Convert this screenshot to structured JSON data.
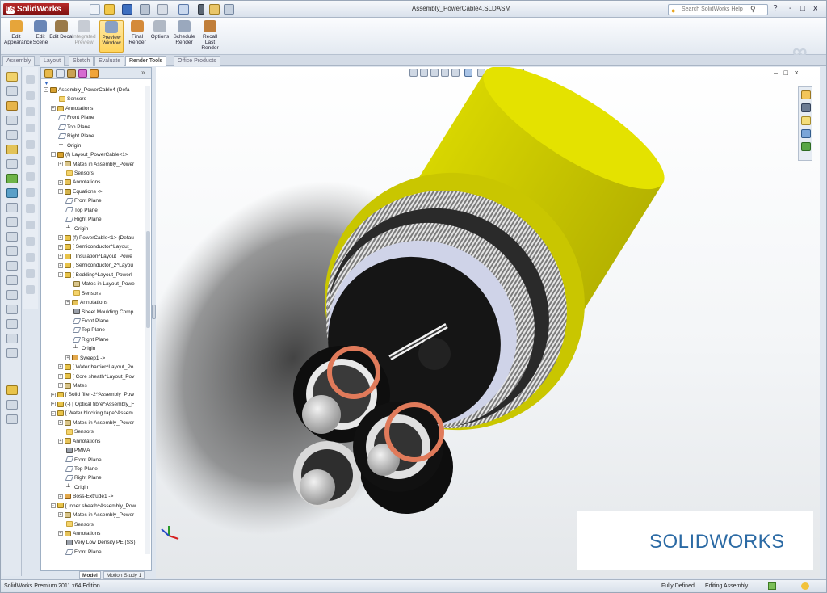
{
  "app": {
    "logo_text": "SolidWorks",
    "document_title": "Assembly_PowerCable4.SLDASM",
    "search_placeholder": "Search SolidWorks Help",
    "window_controls": [
      "?",
      "-",
      "□",
      "x"
    ]
  },
  "commands": [
    {
      "name": "edit-appearance",
      "label": "Edit Appearance",
      "icon": "appearance-icon"
    },
    {
      "name": "edit-scene",
      "label": "Edit Scene",
      "icon": "scene-icon"
    },
    {
      "name": "edit-decal",
      "label": "Edit Decal",
      "icon": "decal-icon"
    },
    {
      "name": "integrated-preview",
      "label": "Integrated Preview",
      "icon": "preview-icon",
      "disabled": true
    },
    {
      "name": "preview-window",
      "label": "Preview Window",
      "icon": "preview-window-icon",
      "active": true
    },
    {
      "name": "final-render",
      "label": "Final Render",
      "icon": "render-icon"
    },
    {
      "name": "options",
      "label": "Options",
      "icon": "options-icon"
    },
    {
      "name": "schedule-render",
      "label": "Schedule Render",
      "icon": "schedule-icon"
    },
    {
      "name": "recall-last-render",
      "label": "Recall Last Render",
      "icon": "recall-icon"
    }
  ],
  "tabs": [
    "Assembly",
    "Layout",
    "Sketch",
    "Evaluate",
    "Render Tools",
    "Office Products"
  ],
  "active_tab": "Render Tools",
  "tree": [
    {
      "depth": 0,
      "icon": "asm",
      "label": "Assembly_PowerCable4  (Defa",
      "exp": "-"
    },
    {
      "depth": 1,
      "icon": "folder",
      "label": "Sensors"
    },
    {
      "depth": 1,
      "icon": "annot",
      "label": "Annotations",
      "exp": "+"
    },
    {
      "depth": 1,
      "icon": "plane",
      "label": "Front Plane"
    },
    {
      "depth": 1,
      "icon": "plane",
      "label": "Top Plane"
    },
    {
      "depth": 1,
      "icon": "plane",
      "label": "Right Plane"
    },
    {
      "depth": 1,
      "icon": "origin",
      "label": "Origin"
    },
    {
      "depth": 1,
      "icon": "asm",
      "label": "(f) Layout_PowerCable<1>",
      "exp": "-"
    },
    {
      "depth": 2,
      "icon": "mates",
      "label": "Mates in Assembly_Power",
      "exp": "+"
    },
    {
      "depth": 2,
      "icon": "folder",
      "label": "Sensors"
    },
    {
      "depth": 2,
      "icon": "annot",
      "label": "Annotations",
      "exp": "+"
    },
    {
      "depth": 2,
      "icon": "eq",
      "label": "Equations ->",
      "exp": "+"
    },
    {
      "depth": 2,
      "icon": "plane",
      "label": "Front Plane"
    },
    {
      "depth": 2,
      "icon": "plane",
      "label": "Top Plane"
    },
    {
      "depth": 2,
      "icon": "plane",
      "label": "Right Plane"
    },
    {
      "depth": 2,
      "icon": "origin",
      "label": "Origin"
    },
    {
      "depth": 2,
      "icon": "part",
      "label": "(f) PowerCable<1> (Defau",
      "exp": "+"
    },
    {
      "depth": 2,
      "icon": "part",
      "label": "[ Semiconductor^Layout_",
      "exp": "+"
    },
    {
      "depth": 2,
      "icon": "part",
      "label": "[ Insulation^Layout_Powe",
      "exp": "+"
    },
    {
      "depth": 2,
      "icon": "part",
      "label": "[ Semiconductor_2^Layou",
      "exp": "+"
    },
    {
      "depth": 2,
      "icon": "part",
      "label": "[ Bedding^Layout_Powerl",
      "exp": "-"
    },
    {
      "depth": 3,
      "icon": "mates",
      "label": "Mates in Layout_Powe"
    },
    {
      "depth": 3,
      "icon": "folder",
      "label": "Sensors"
    },
    {
      "depth": 3,
      "icon": "annot",
      "label": "Annotations",
      "exp": "+"
    },
    {
      "depth": 3,
      "icon": "mat",
      "label": "Sheet Moulding Comp"
    },
    {
      "depth": 3,
      "icon": "plane",
      "label": "Front Plane"
    },
    {
      "depth": 3,
      "icon": "plane",
      "label": "Top Plane"
    },
    {
      "depth": 3,
      "icon": "plane",
      "label": "Right Plane"
    },
    {
      "depth": 3,
      "icon": "origin",
      "label": "Origin"
    },
    {
      "depth": 3,
      "icon": "feat",
      "label": "Sweep1 ->",
      "exp": "+"
    },
    {
      "depth": 2,
      "icon": "part",
      "label": "[ Water barrier^Layout_Po",
      "exp": "+"
    },
    {
      "depth": 2,
      "icon": "part",
      "label": "[ Core sheath^Layout_Pov",
      "exp": "+"
    },
    {
      "depth": 2,
      "icon": "mates",
      "label": "Mates",
      "exp": "+"
    },
    {
      "depth": 1,
      "icon": "part",
      "label": "[ Solid filler-2^Assembly_Pow",
      "exp": "+"
    },
    {
      "depth": 1,
      "icon": "part",
      "label": "(-) [ Optical fibre^Assembly_F",
      "exp": "+"
    },
    {
      "depth": 1,
      "icon": "part",
      "label": "[ Water blocking tape^Assem",
      "exp": "-"
    },
    {
      "depth": 2,
      "icon": "mates",
      "label": "Mates in Assembly_Power",
      "exp": "+"
    },
    {
      "depth": 2,
      "icon": "folder",
      "label": "Sensors"
    },
    {
      "depth": 2,
      "icon": "annot",
      "label": "Annotations",
      "exp": "+"
    },
    {
      "depth": 2,
      "icon": "mat",
      "label": "PMMA"
    },
    {
      "depth": 2,
      "icon": "plane",
      "label": "Front Plane"
    },
    {
      "depth": 2,
      "icon": "plane",
      "label": "Top Plane"
    },
    {
      "depth": 2,
      "icon": "plane",
      "label": "Right Plane"
    },
    {
      "depth": 2,
      "icon": "origin",
      "label": "Origin"
    },
    {
      "depth": 2,
      "icon": "feat",
      "label": "Boss-Extrude1 ->",
      "exp": "+"
    },
    {
      "depth": 1,
      "icon": "part",
      "label": "[ Inner sheath^Assembly_Pow",
      "exp": "-"
    },
    {
      "depth": 2,
      "icon": "mates",
      "label": "Mates in Assembly_Power",
      "exp": "+"
    },
    {
      "depth": 2,
      "icon": "folder",
      "label": "Sensors"
    },
    {
      "depth": 2,
      "icon": "annot",
      "label": "Annotations",
      "exp": "+"
    },
    {
      "depth": 2,
      "icon": "mat",
      "label": "Very Low Density PE (SS)"
    },
    {
      "depth": 2,
      "icon": "plane",
      "label": "Front Plane"
    }
  ],
  "bottom_tabs": [
    "Model",
    "Motion Study 1"
  ],
  "status": {
    "edition": "SolidWorks Premium 2011 x64 Edition",
    "definition": "Fully Defined",
    "mode": "Editing Assembly"
  },
  "brand_label": "SOLIDWORKS",
  "colors": {
    "jacket_yellow": "#d8d600",
    "armor_grey": "#9c9c9c",
    "semicon_orange": "#e07a5a",
    "brand_blue": "#2b6aa4"
  }
}
